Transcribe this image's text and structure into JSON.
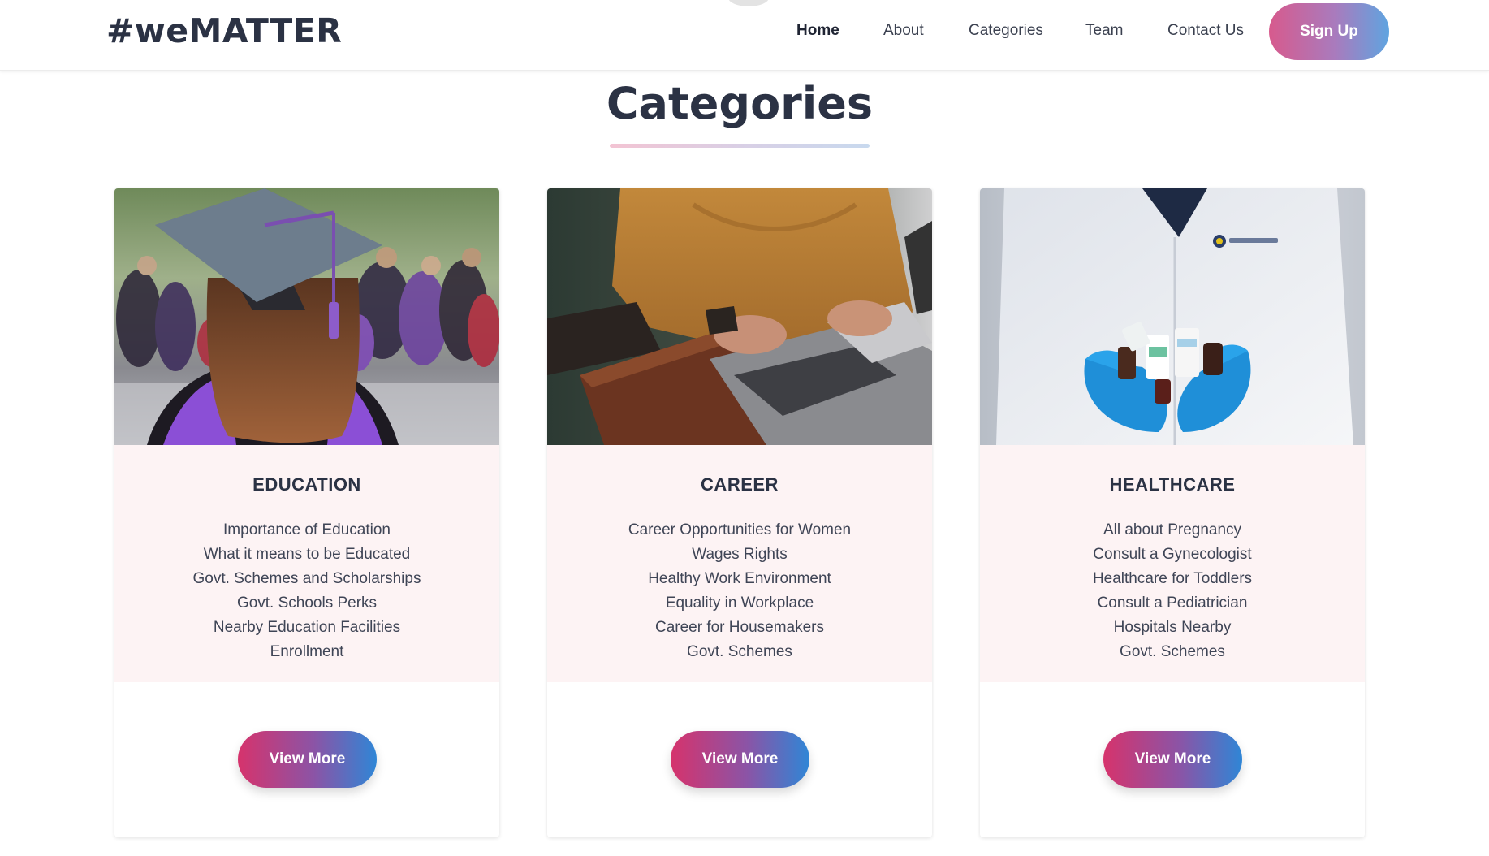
{
  "header": {
    "brand": "#weMATTER",
    "nav": [
      "Home",
      "About",
      "Categories",
      "Team",
      "Contact Us"
    ],
    "active": "Home",
    "signup_label": "Sign Up"
  },
  "section": {
    "title": "Categories"
  },
  "cards": [
    {
      "title": "EDUCATION",
      "image": "graduate-in-cap-photo",
      "items": [
        "Importance of Education",
        "What it means to be Educated",
        "Govt. Schemes and Scholarships",
        "Govt. Schools Perks",
        "Nearby Education Facilities",
        "Enrollment"
      ],
      "button_label": "View More"
    },
    {
      "title": "CAREER",
      "image": "person-typing-on-laptop-photo",
      "items": [
        "Career Opportunities for Women",
        "Wages Rights",
        "Healthy Work Environment",
        "Equality in Workplace",
        "Career for Housemakers",
        "Govt. Schemes"
      ],
      "button_label": "View More"
    },
    {
      "title": "HEALTHCARE",
      "image": "doctor-holding-medicines-photo",
      "items": [
        "All about Pregnancy",
        "Consult a Gynecologist",
        "Healthcare for Toddlers",
        "Consult a Pediatrician",
        "Hospitals Nearby",
        "Govt. Schemes"
      ],
      "button_label": "View More"
    }
  ],
  "colors": {
    "text_dark": "#2b3244",
    "card_body_bg": "#fdf3f4",
    "gradient_pink": "#d6336c",
    "gradient_blue": "#2f86d6"
  }
}
